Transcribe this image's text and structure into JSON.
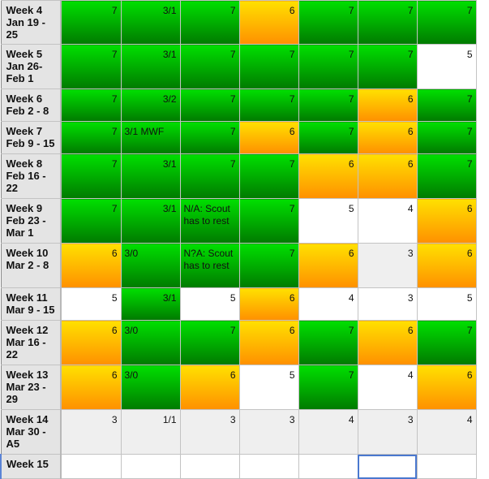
{
  "colors": {
    "green": "#00c800",
    "orange": "#ffb800",
    "white": "#ffffff",
    "gray": "#efefef",
    "selection": "#4a78cf"
  },
  "rows": [
    {
      "label": "Week 4 Jan 19 - 25",
      "cells": [
        {
          "text": "7",
          "color": "green"
        },
        {
          "text": "3/1",
          "color": "green"
        },
        {
          "text": "7",
          "color": "green"
        },
        {
          "text": "6",
          "color": "orange"
        },
        {
          "text": "7",
          "color": "green"
        },
        {
          "text": "7",
          "color": "green"
        },
        {
          "text": "7",
          "color": "green"
        }
      ]
    },
    {
      "label": "Week 5 Jan 26- Feb 1",
      "cells": [
        {
          "text": "7",
          "color": "green"
        },
        {
          "text": "3/1",
          "color": "green"
        },
        {
          "text": "7",
          "color": "green"
        },
        {
          "text": "7",
          "color": "green"
        },
        {
          "text": "7",
          "color": "green"
        },
        {
          "text": "7",
          "color": "green"
        },
        {
          "text": "5",
          "color": "white"
        }
      ]
    },
    {
      "label": "Week 6 Feb 2 - 8",
      "cells": [
        {
          "text": "7",
          "color": "green"
        },
        {
          "text": "3/2",
          "color": "green"
        },
        {
          "text": "7",
          "color": "green"
        },
        {
          "text": "7",
          "color": "green"
        },
        {
          "text": "7",
          "color": "green"
        },
        {
          "text": "6",
          "color": "orange"
        },
        {
          "text": "7",
          "color": "green"
        }
      ]
    },
    {
      "label": "Week 7 Feb 9 - 15",
      "cells": [
        {
          "text": "7",
          "color": "green"
        },
        {
          "text": "3/1 MWF",
          "color": "green",
          "align": "left"
        },
        {
          "text": "7",
          "color": "green"
        },
        {
          "text": "6",
          "color": "orange"
        },
        {
          "text": "7",
          "color": "green"
        },
        {
          "text": "6",
          "color": "orange"
        },
        {
          "text": "7",
          "color": "green"
        }
      ]
    },
    {
      "label": "Week 8 Feb 16 - 22",
      "cells": [
        {
          "text": "7",
          "color": "green"
        },
        {
          "text": "3/1",
          "color": "green"
        },
        {
          "text": "7",
          "color": "green"
        },
        {
          "text": "7",
          "color": "green"
        },
        {
          "text": "6",
          "color": "orange"
        },
        {
          "text": "6",
          "color": "orange"
        },
        {
          "text": "7",
          "color": "green"
        }
      ]
    },
    {
      "label": "Week 9 Feb 23 - Mar 1",
      "cells": [
        {
          "text": "7",
          "color": "green"
        },
        {
          "text": "3/1",
          "color": "green"
        },
        {
          "text": "N/A: Scout has to rest",
          "color": "green",
          "align": "left"
        },
        {
          "text": "7",
          "color": "green"
        },
        {
          "text": "5",
          "color": "white"
        },
        {
          "text": "4",
          "color": "white"
        },
        {
          "text": "6",
          "color": "orange"
        }
      ]
    },
    {
      "label": "Week 10 Mar 2 - 8",
      "cells": [
        {
          "text": "6",
          "color": "orange"
        },
        {
          "text": "3/0",
          "color": "green",
          "align": "left"
        },
        {
          "text": "N?A: Scout has to rest",
          "color": "green",
          "align": "left"
        },
        {
          "text": "7",
          "color": "green"
        },
        {
          "text": "6",
          "color": "orange"
        },
        {
          "text": "3",
          "color": "gray"
        },
        {
          "text": "6",
          "color": "orange"
        }
      ]
    },
    {
      "label": "Week 11 Mar 9 - 15",
      "cells": [
        {
          "text": "5",
          "color": "white"
        },
        {
          "text": "3/1",
          "color": "green"
        },
        {
          "text": "5",
          "color": "white"
        },
        {
          "text": "6",
          "color": "orange"
        },
        {
          "text": "4",
          "color": "white"
        },
        {
          "text": "3",
          "color": "white"
        },
        {
          "text": "5",
          "color": "white"
        }
      ]
    },
    {
      "label": "Week 12 Mar 16 - 22",
      "cells": [
        {
          "text": "6",
          "color": "orange"
        },
        {
          "text": "3/0",
          "color": "green",
          "align": "left"
        },
        {
          "text": "7",
          "color": "green"
        },
        {
          "text": "6",
          "color": "orange"
        },
        {
          "text": "7",
          "color": "green"
        },
        {
          "text": "6",
          "color": "orange"
        },
        {
          "text": "7",
          "color": "green"
        }
      ]
    },
    {
      "label": "Week 13 Mar 23 - 29",
      "cells": [
        {
          "text": "6",
          "color": "orange"
        },
        {
          "text": "3/0",
          "color": "green",
          "align": "left"
        },
        {
          "text": "6",
          "color": "orange"
        },
        {
          "text": "5",
          "color": "white"
        },
        {
          "text": "7",
          "color": "green"
        },
        {
          "text": "4",
          "color": "white"
        },
        {
          "text": "6",
          "color": "orange"
        }
      ]
    },
    {
      "label": "Week 14 Mar 30 - A5",
      "cells": [
        {
          "text": "3",
          "color": "gray"
        },
        {
          "text": "1/1",
          "color": "gray"
        },
        {
          "text": "3",
          "color": "gray"
        },
        {
          "text": "3",
          "color": "gray"
        },
        {
          "text": "4",
          "color": "gray"
        },
        {
          "text": "3",
          "color": "gray"
        },
        {
          "text": "4",
          "color": "gray"
        }
      ]
    },
    {
      "label": "Week 15",
      "active": true,
      "cells": [
        {
          "text": "",
          "color": "white"
        },
        {
          "text": "",
          "color": "white"
        },
        {
          "text": "",
          "color": "white"
        },
        {
          "text": "",
          "color": "white"
        },
        {
          "text": "",
          "color": "white"
        },
        {
          "text": "",
          "color": "white",
          "selected": true
        },
        {
          "text": "",
          "color": "white"
        }
      ]
    }
  ]
}
